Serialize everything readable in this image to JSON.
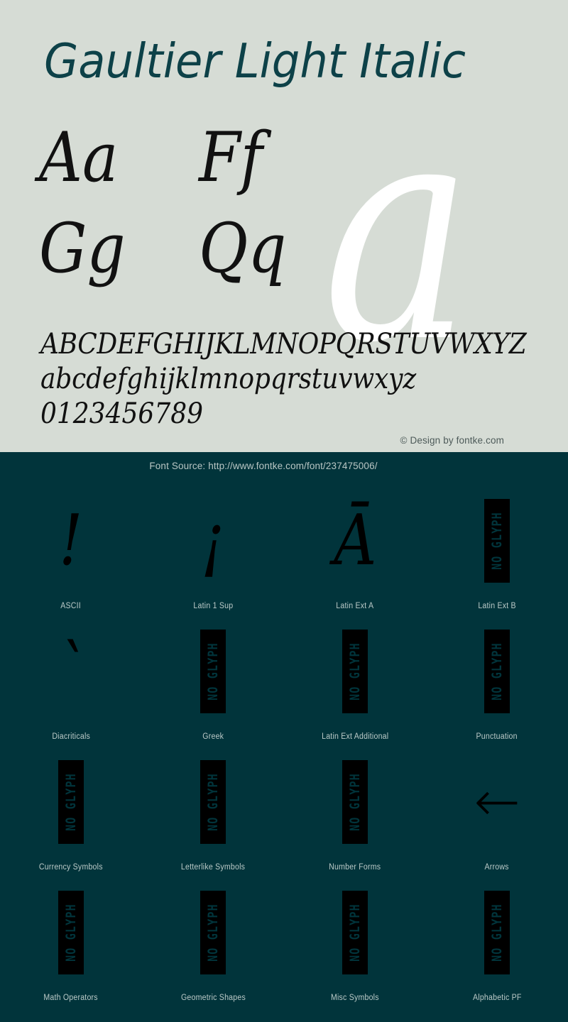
{
  "colors": {
    "light_bg": "#d6dcd5",
    "dark_bg": "#01343b",
    "title_teal": "#0d4148",
    "glyph_black": "#000000",
    "watermark_white": "#ffffff",
    "label_text": "#bccac8",
    "copyright_text": "#4d5a59"
  },
  "top": {
    "title": "Gaultier Light Italic",
    "watermark_glyph": "a",
    "samples": [
      [
        "Aa",
        "Ff"
      ],
      [
        "Gg",
        "Qq"
      ]
    ],
    "alphabet_upper": "ABCDEFGHIJKLMNOPQRSTUVWXYZ",
    "alphabet_lower": "abcdefghijklmnopqrstuvwxyz",
    "digits": "0123456789",
    "copyright": "© Design by fontke.com"
  },
  "bottom": {
    "font_source": "Font Source: http://www.fontke.com/font/237475006/",
    "no_glyph_label": "NO GLYPH",
    "blocks": [
      {
        "label": "ASCII",
        "glyph": "!",
        "no_glyph": false
      },
      {
        "label": "Latin 1 Sup",
        "glyph": "¡",
        "no_glyph": false
      },
      {
        "label": "Latin Ext A",
        "glyph": "Ā",
        "no_glyph": false
      },
      {
        "label": "Latin Ext B",
        "glyph": "",
        "no_glyph": true
      },
      {
        "label": "Diacriticals",
        "glyph": "ˋ",
        "no_glyph": false
      },
      {
        "label": "Greek",
        "glyph": "",
        "no_glyph": true
      },
      {
        "label": "Latin Ext Additional",
        "glyph": "",
        "no_glyph": true
      },
      {
        "label": "Punctuation",
        "glyph": "",
        "no_glyph": true
      },
      {
        "label": "Currency Symbols",
        "glyph": "",
        "no_glyph": true
      },
      {
        "label": "Letterlike Symbols",
        "glyph": "",
        "no_glyph": true
      },
      {
        "label": "Number Forms",
        "glyph": "",
        "no_glyph": true
      },
      {
        "label": "Arrows",
        "glyph": "←",
        "no_glyph": false,
        "icon": "left-arrow-icon"
      },
      {
        "label": "Math Operators",
        "glyph": "",
        "no_glyph": true
      },
      {
        "label": "Geometric Shapes",
        "glyph": "",
        "no_glyph": true
      },
      {
        "label": "Misc Symbols",
        "glyph": "",
        "no_glyph": true
      },
      {
        "label": "Alphabetic PF",
        "glyph": "",
        "no_glyph": true
      }
    ]
  }
}
